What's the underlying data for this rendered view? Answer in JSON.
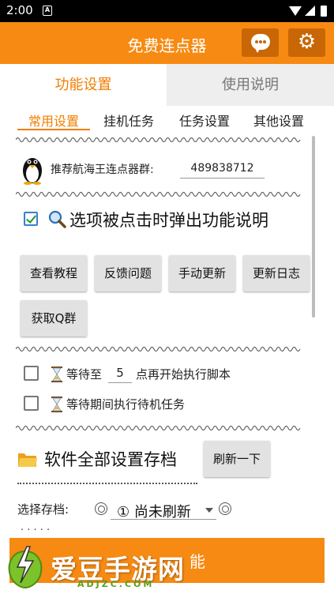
{
  "status_bar": {
    "time": "2:00",
    "sim_label": "A"
  },
  "app_bar": {
    "title": "免费连点器",
    "icons": [
      "chat-icon",
      "gear-icon"
    ]
  },
  "main_tabs": [
    {
      "label": "功能设置",
      "active": true
    },
    {
      "label": "使用说明",
      "active": false
    }
  ],
  "sub_tabs": [
    {
      "label": "常用设置",
      "active": true
    },
    {
      "label": "挂机任务",
      "active": false
    },
    {
      "label": "任务设置",
      "active": false
    },
    {
      "label": "其他设置",
      "active": false
    }
  ],
  "group": {
    "label": "推荐航海王连点器群:",
    "value": "489838712"
  },
  "tip": {
    "checked": true,
    "text": "选项被点击时弹出功能说明"
  },
  "buttons": [
    "查看教程",
    "反馈问题",
    "手动更新",
    "更新日志",
    "获取Q群"
  ],
  "wait": {
    "row1_prefix": "等待至",
    "row1_value": "5",
    "row1_suffix": "点再开始执行脚本",
    "row2_text": "等待期间执行待机任务"
  },
  "save": {
    "title": "软件全部设置存档",
    "refresh_label": "刷新一下",
    "select_label": "选择存档:",
    "selected_value": "① 尚未刷新"
  },
  "bottom": {
    "partial_text": "能"
  },
  "watermark": {
    "text": "爱豆手游网",
    "sub": "ADJZC.COM"
  },
  "colors": {
    "accent": "#f78a12",
    "accent_dark": "#c96605",
    "tab_active_text": "#f07e00"
  }
}
